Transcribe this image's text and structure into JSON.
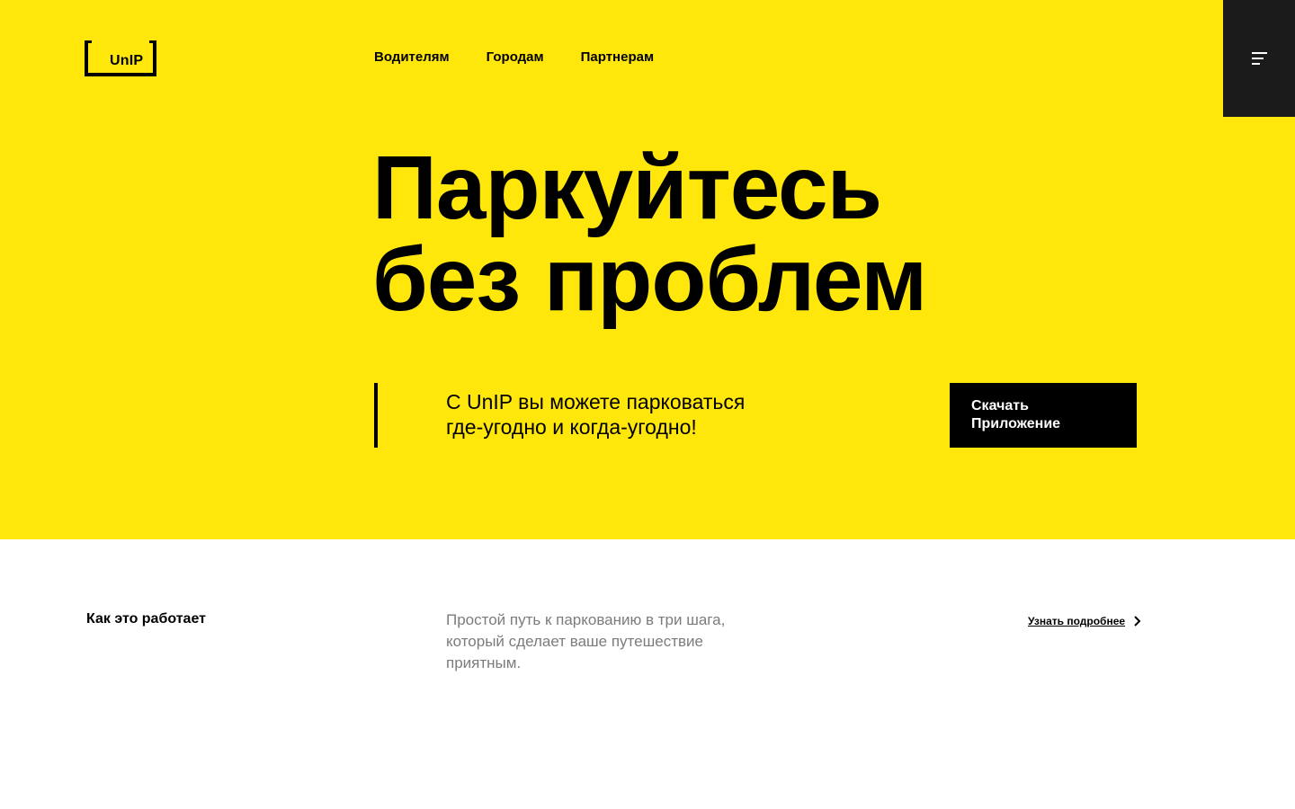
{
  "brand": {
    "logo_text": "UnIP",
    "accent_color": "#FFE60B",
    "dark_color": "#1b1b1b"
  },
  "nav": {
    "items": [
      {
        "label": "Водителям"
      },
      {
        "label": "Городам"
      },
      {
        "label": "Партнерам"
      }
    ]
  },
  "menu": {
    "icon": "hamburger-menu-icon"
  },
  "hero": {
    "title_line1": "Паркуйтесь",
    "title_line2": "без проблем",
    "tagline_line1": "С UnIP вы можете парковаться",
    "tagline_line2": "где-угодно и когда-угодно!",
    "cta_line1": "Скачать",
    "cta_line2": "Приложение"
  },
  "how_it_works": {
    "title": "Как это работает",
    "description_line1": "Простой путь к паркованию в три шага,",
    "description_line2": "который сделает ваше путешествие",
    "description_line3": "приятным.",
    "link_label": "Узнать подробнее",
    "link_icon": "chevron-right-icon"
  }
}
